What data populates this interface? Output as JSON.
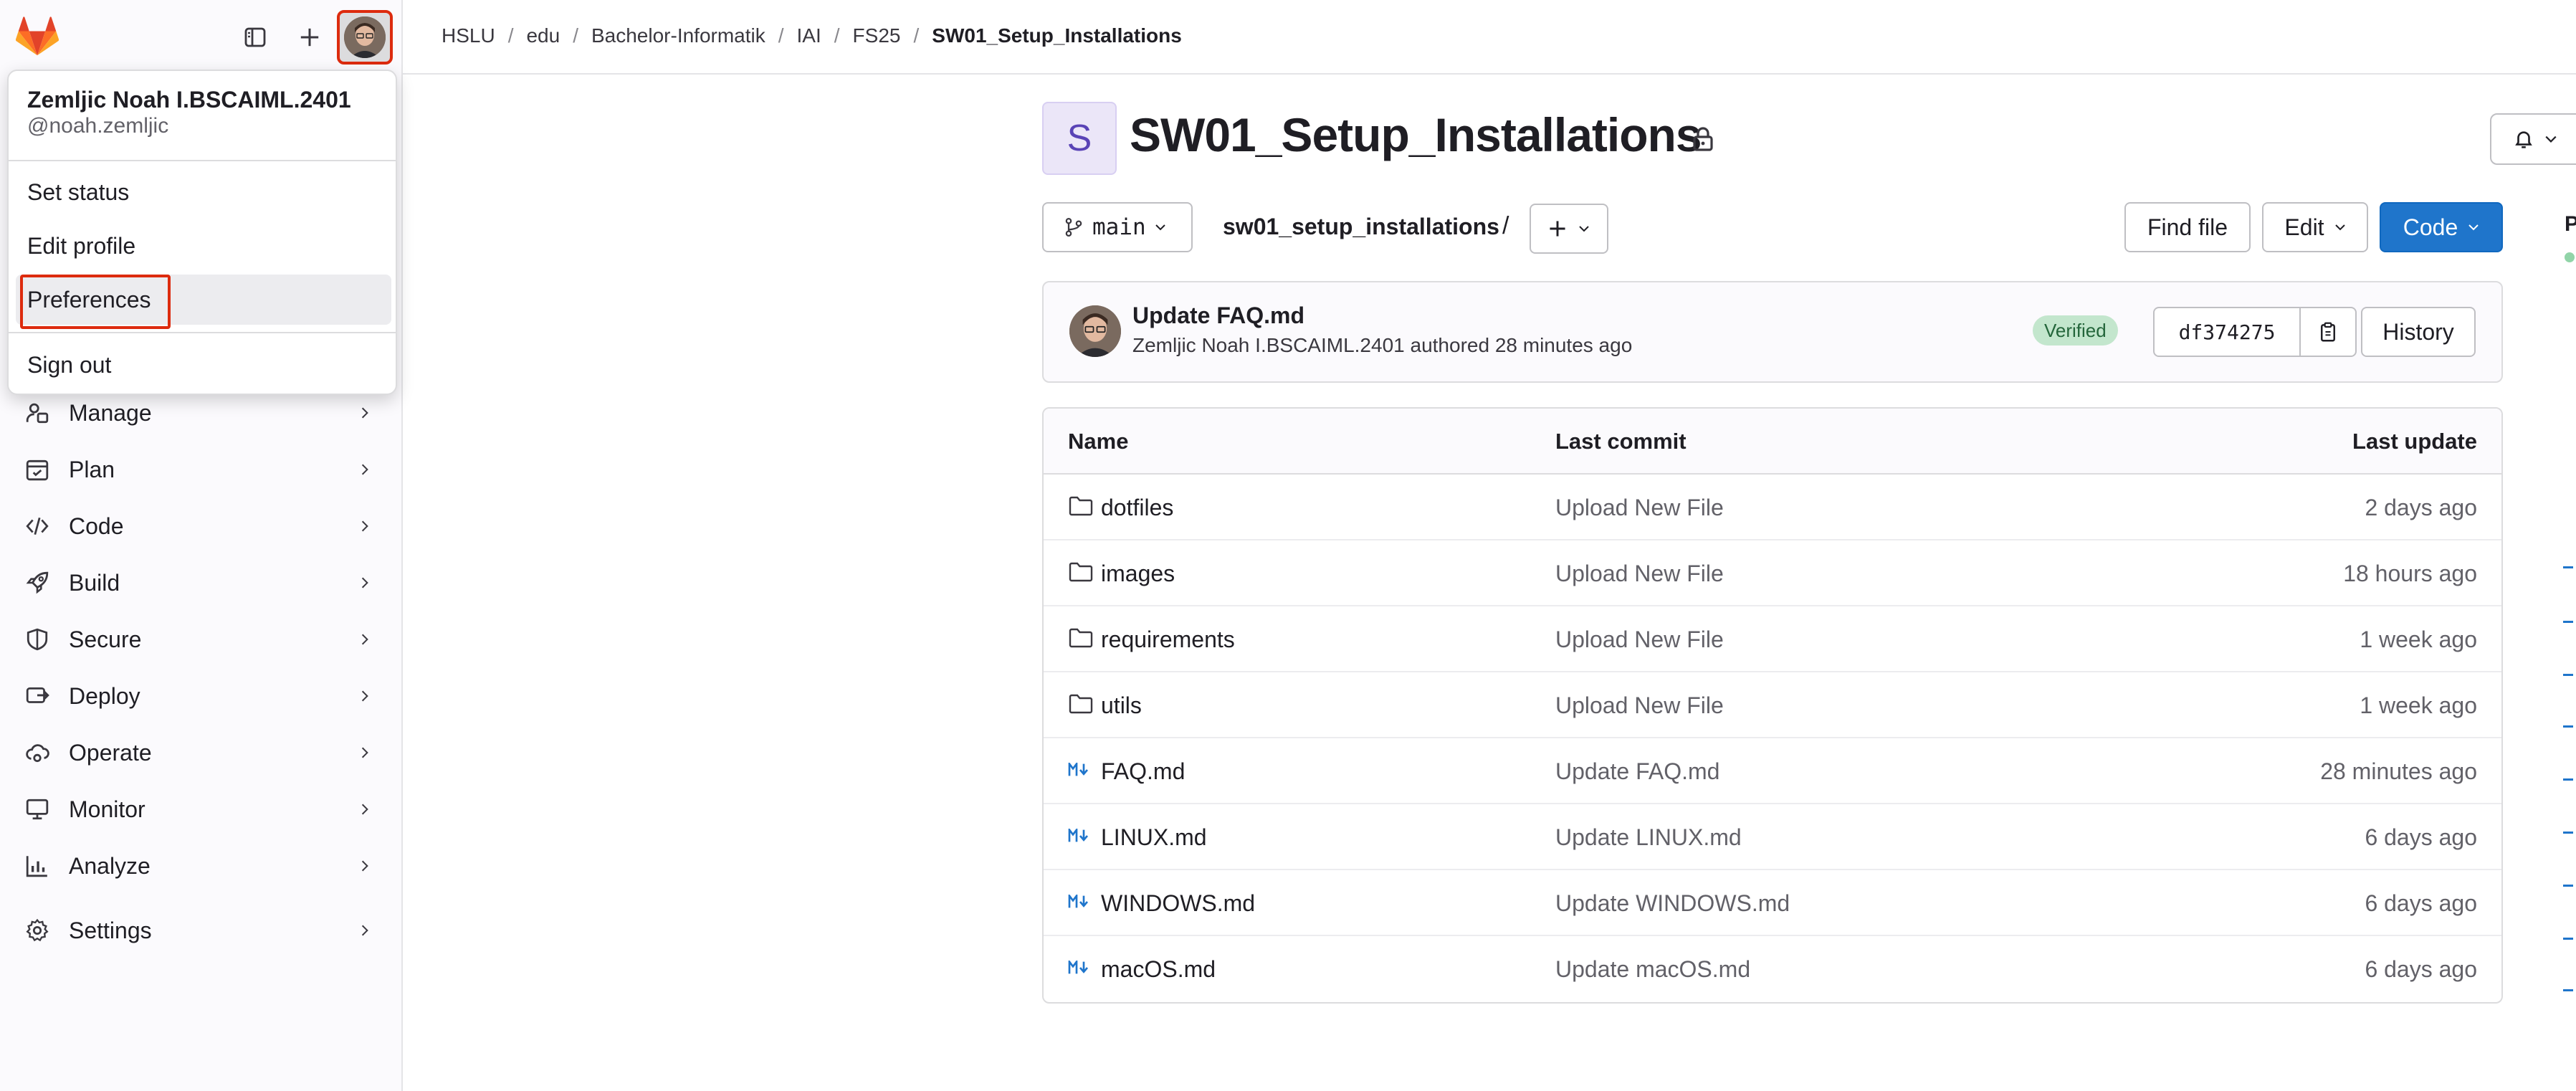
{
  "header": {
    "breadcrumbs": [
      {
        "label": "HSLU"
      },
      {
        "label": "edu"
      },
      {
        "label": "Bachelor-Informatik"
      },
      {
        "label": "IAI"
      },
      {
        "label": "FS25"
      },
      {
        "label": "SW01_Setup_Installations"
      }
    ]
  },
  "user_menu": {
    "name": "Zemljic Noah I.BSCAIML.2401",
    "username": "@noah.zemljic",
    "items": [
      {
        "label": "Set status"
      },
      {
        "label": "Edit profile"
      },
      {
        "label": "Preferences"
      },
      {
        "label": "Sign out"
      }
    ]
  },
  "sidebar": {
    "items": [
      {
        "label": "Manage",
        "icon": "users-icon"
      },
      {
        "label": "Plan",
        "icon": "calendar-icon"
      },
      {
        "label": "Code",
        "icon": "code-icon"
      },
      {
        "label": "Build",
        "icon": "rocket-icon"
      },
      {
        "label": "Secure",
        "icon": "shield-icon"
      },
      {
        "label": "Deploy",
        "icon": "deploy-icon"
      },
      {
        "label": "Operate",
        "icon": "cloud-gear-icon"
      },
      {
        "label": "Monitor",
        "icon": "monitor-icon"
      },
      {
        "label": "Analyze",
        "icon": "chart-icon"
      },
      {
        "label": "Settings",
        "icon": "gear-icon"
      }
    ]
  },
  "project": {
    "avatar_letter": "S",
    "title": "SW01_Setup_Installations",
    "branch": "main",
    "path": "sw01_setup_installations",
    "path_separator": "/",
    "find_file_label": "Find file",
    "edit_label": "Edit",
    "code_label": "Code"
  },
  "commit": {
    "title": "Update FAQ.md",
    "author": "Zemljic Noah I.BSCAIML.2401",
    "meta_suffix": "authored 28 minutes ago",
    "verified_label": "Verified",
    "sha": "df374275",
    "history_label": "History"
  },
  "files": {
    "columns": [
      "Name",
      "Last commit",
      "Last update"
    ],
    "rows": [
      {
        "name": "dotfiles",
        "type": "folder",
        "commit": "Upload New File",
        "updated": "2 days ago"
      },
      {
        "name": "images",
        "type": "folder",
        "commit": "Upload New File",
        "updated": "18 hours ago"
      },
      {
        "name": "requirements",
        "type": "folder",
        "commit": "Upload New File",
        "updated": "1 week ago"
      },
      {
        "name": "utils",
        "type": "folder",
        "commit": "Upload New File",
        "updated": "1 week ago"
      },
      {
        "name": "FAQ.md",
        "type": "markdown",
        "commit": "Update FAQ.md",
        "updated": "28 minutes ago"
      },
      {
        "name": "LINUX.md",
        "type": "markdown",
        "commit": "Update LINUX.md",
        "updated": "6 days ago"
      },
      {
        "name": "WINDOWS.md",
        "type": "markdown",
        "commit": "Update WINDOWS.md",
        "updated": "6 days ago"
      },
      {
        "name": "macOS.md",
        "type": "markdown",
        "commit": "Update macOS.md",
        "updated": "6 days ago"
      }
    ]
  },
  "colors": {
    "accent": "#1f75cb",
    "highlight_outline": "#dd2b0e",
    "verified_bg": "#c3e6cd",
    "gitlab_orange": "#fc6d26"
  }
}
